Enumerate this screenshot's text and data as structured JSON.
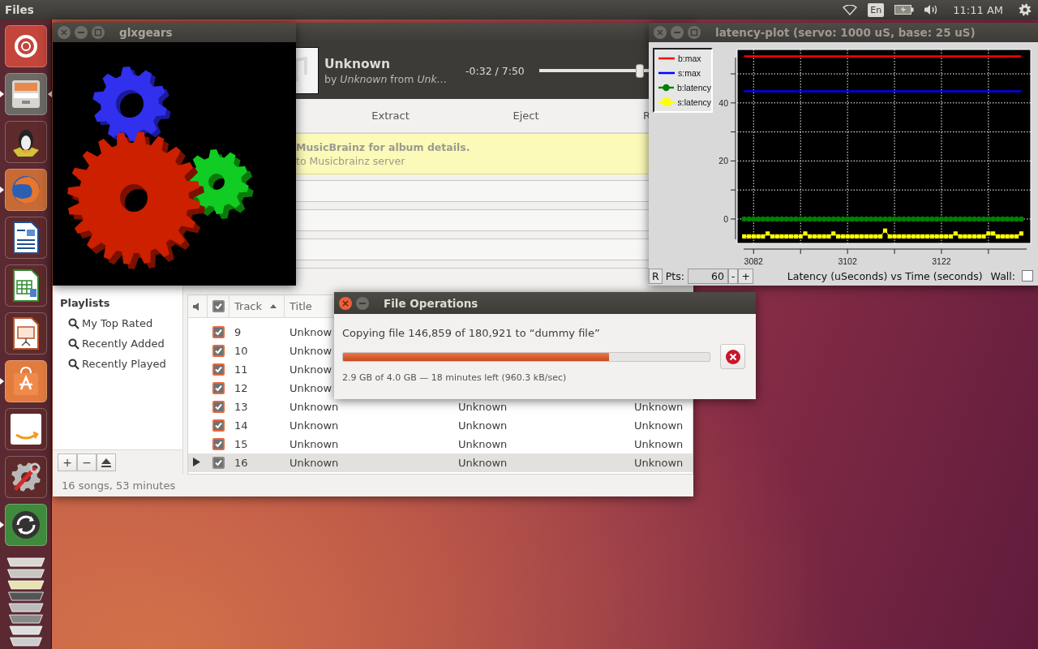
{
  "top_panel": {
    "app_title": "Files",
    "language": "En",
    "clock": "11:11 AM"
  },
  "launcher": [
    {
      "running": false,
      "focused": false
    },
    {
      "running": true,
      "focused": true
    },
    {
      "running": false,
      "focused": false
    },
    {
      "running": true,
      "focused": false
    },
    {
      "running": false,
      "focused": false
    },
    {
      "running": false,
      "focused": false
    },
    {
      "running": false,
      "focused": false
    },
    {
      "running": true,
      "focused": false
    },
    {
      "running": false,
      "focused": false
    },
    {
      "running": false,
      "focused": false
    },
    {
      "running": true,
      "focused": false
    }
  ],
  "glxgears": {
    "title": "glxgears"
  },
  "music_player": {
    "now_playing": {
      "title": "Unknown",
      "byline": "by *Unknown* from *Unk…*",
      "time": "-0:32 / 7:50",
      "level": 0.95
    },
    "toolbar": [
      "Extract",
      "Eject",
      "R"
    ],
    "info_bar": {
      "heading": "MusicBrainz for album details.",
      "detail": "to Musicbrainz server"
    },
    "sidebar": {
      "heading": "Playlists",
      "items": [
        "My Top Rated",
        "Recently Added",
        "Recently Played"
      ]
    },
    "sidebar_buttons": [
      "+",
      "−"
    ],
    "table": {
      "header_checked": true,
      "columns": [
        {
          "label": "Track",
          "sorted": true
        },
        {
          "label": "Title",
          "sorted": false
        }
      ],
      "rows": [
        {
          "playing": false,
          "selected": false,
          "checked": true,
          "track": "9",
          "title": "Unknow"
        },
        {
          "playing": false,
          "selected": false,
          "checked": true,
          "track": "10",
          "title": "Unknow"
        },
        {
          "playing": false,
          "selected": false,
          "checked": true,
          "track": "11",
          "title": "Unknow"
        },
        {
          "playing": false,
          "selected": false,
          "checked": true,
          "track": "12",
          "title": "Unknow"
        },
        {
          "playing": false,
          "selected": false,
          "checked": true,
          "track": "13",
          "title": "Unknown",
          "column_3": "Unknown",
          "column_4": "Unknown"
        },
        {
          "playing": false,
          "selected": false,
          "checked": true,
          "track": "14",
          "title": "Unknown",
          "column_3": "Unknown",
          "column_4": "Unknown"
        },
        {
          "playing": false,
          "selected": false,
          "checked": true,
          "track": "15",
          "title": "Unknown",
          "column_3": "Unknown",
          "column_4": "Unknown"
        },
        {
          "playing": true,
          "selected": true,
          "checked": true,
          "track": "16",
          "title": "Unknown",
          "column_3": "Unknown",
          "column_4": "Unknown"
        }
      ]
    },
    "status": "16 songs, 53 minutes"
  },
  "latency_plot": {
    "title": "latency-plot (servo: 1000 uS, base: 25 uS)",
    "chart_data": {
      "type": "line",
      "grid": true,
      "xlabel": "Latency (uSeconds) vs Time (seconds)",
      "xlim": [
        3078.5,
        3141
      ],
      "ylim": [
        -8.4,
        58.4
      ],
      "xticks": [
        3082,
        3102,
        3122
      ],
      "yticks": [
        0,
        20,
        40
      ],
      "x": [
        3080,
        3081,
        3082,
        3083,
        3084,
        3085,
        3086,
        3087,
        3088,
        3089,
        3090,
        3091,
        3092,
        3093,
        3094,
        3095,
        3096,
        3097,
        3098,
        3099,
        3100,
        3101,
        3102,
        3103,
        3104,
        3105,
        3106,
        3107,
        3108,
        3109,
        3110,
        3111,
        3112,
        3113,
        3114,
        3115,
        3116,
        3117,
        3118,
        3119,
        3120,
        3121,
        3122,
        3123,
        3124,
        3125,
        3126,
        3127,
        3128,
        3129,
        3130,
        3131,
        3132,
        3133,
        3134,
        3135,
        3136,
        3137,
        3138,
        3139
      ],
      "series": [
        {
          "name": "b:max",
          "color": "#ff0000",
          "marker": "none",
          "values": [
            56,
            56,
            56,
            56,
            56,
            56,
            56,
            56,
            56,
            56,
            56,
            56,
            56,
            56,
            56,
            56,
            56,
            56,
            56,
            56,
            56,
            56,
            56,
            56,
            56,
            56,
            56,
            56,
            56,
            56,
            56,
            56,
            56,
            56,
            56,
            56,
            56,
            56,
            56,
            56,
            56,
            56,
            56,
            56,
            56,
            56,
            56,
            56,
            56,
            56,
            56,
            56,
            56,
            56,
            56,
            56,
            56,
            56,
            56,
            56
          ]
        },
        {
          "name": "s:max",
          "color": "#0000ff",
          "marker": "none",
          "values": [
            44,
            44,
            44,
            44,
            44,
            44,
            44,
            44,
            44,
            44,
            44,
            44,
            44,
            44,
            44,
            44,
            44,
            44,
            44,
            44,
            44,
            44,
            44,
            44,
            44,
            44,
            44,
            44,
            44,
            44,
            44,
            44,
            44,
            44,
            44,
            44,
            44,
            44,
            44,
            44,
            44,
            44,
            44,
            44,
            44,
            44,
            44,
            44,
            44,
            44,
            44,
            44,
            44,
            44,
            44,
            44,
            44,
            44,
            44,
            44
          ]
        },
        {
          "name": "b:latency",
          "color": "#008000",
          "marker": "circle",
          "values": [
            0,
            0,
            0,
            0,
            0,
            0,
            0,
            0,
            0,
            0,
            0,
            0,
            0,
            0,
            0,
            0,
            0,
            0,
            0,
            0,
            0,
            0,
            0,
            0,
            0,
            0,
            0,
            0,
            0,
            0,
            0,
            0,
            0,
            0,
            0,
            0,
            0,
            0,
            0,
            0,
            0,
            0,
            0,
            0,
            0,
            0,
            0,
            0,
            0,
            0,
            0,
            0,
            0,
            0,
            0,
            0,
            0,
            0,
            0,
            0
          ]
        },
        {
          "name": "s:latency",
          "color": "#ffff00",
          "marker": "square",
          "values": [
            -6,
            -6,
            -6,
            -6,
            -6,
            -5,
            -6,
            -6,
            -6,
            -6,
            -6,
            -6,
            -6,
            -5,
            -6,
            -6,
            -6,
            -6,
            -6,
            -5,
            -6,
            -6,
            -6,
            -6,
            -6,
            -6,
            -6,
            -6,
            -6,
            -6,
            -4,
            -6,
            -6,
            -6,
            -6,
            -6,
            -6,
            -6,
            -6,
            -6,
            -6,
            -6,
            -6,
            -6,
            -6,
            -5,
            -6,
            -6,
            -6,
            -6,
            -6,
            -6,
            -5,
            -5,
            -6,
            -6,
            -6,
            -6,
            -6,
            -5
          ]
        }
      ]
    },
    "reset_button": "R",
    "points_label": "Pts:",
    "points": "60",
    "minus_button": "-",
    "plus_button": "+",
    "wall_label": "Wall:",
    "wall_checked": false
  },
  "file_operations": {
    "title": "File Operations",
    "message": "Copying file 146,859 of 180,921 to “dummy file”",
    "level": 0.725,
    "details": "2.9 GB of 4.0 GB — 18 minutes left (960.3 kB/sec)"
  }
}
